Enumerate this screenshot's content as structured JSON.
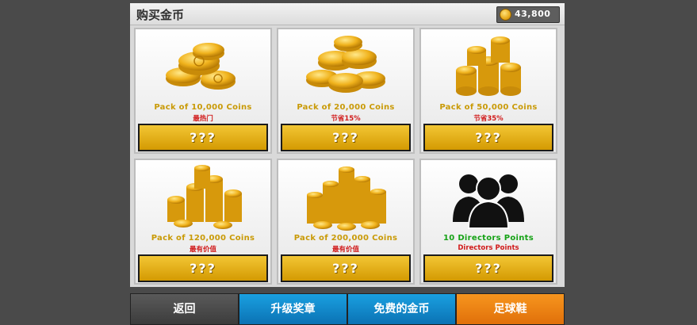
{
  "header": {
    "title": "购买金币",
    "balance": "43,800"
  },
  "packs": [
    {
      "name": "Pack of 10,000 Coins",
      "tag": "最热门",
      "price": "???",
      "icon": "coins-small-icon"
    },
    {
      "name": "Pack of 20,000 Coins",
      "tag": "节省15%",
      "price": "???",
      "icon": "coins-medium-icon"
    },
    {
      "name": "Pack of 50,000 Coins",
      "tag": "节省35%",
      "price": "???",
      "icon": "coins-large-icon"
    },
    {
      "name": "Pack of 120,000 Coins",
      "tag": "最有价值",
      "price": "???",
      "icon": "coins-xlarge-icon"
    },
    {
      "name": "Pack of 200,000 Coins",
      "tag": "最有价值",
      "price": "???",
      "icon": "coins-huge-icon"
    },
    {
      "name": "10 Directors Points",
      "tag": "Directors Points",
      "price": "???",
      "icon": "people-group-icon"
    }
  ],
  "footer": {
    "back": "返回",
    "upgrade": "升级奖章",
    "free_coins": "免费的金币",
    "shoes": "足球鞋"
  },
  "colors": {
    "accent_gold": "#d9a400",
    "tag_red": "#d11a1a",
    "points_green": "#15a215",
    "blue": "#1192d6",
    "orange": "#f08a16"
  }
}
